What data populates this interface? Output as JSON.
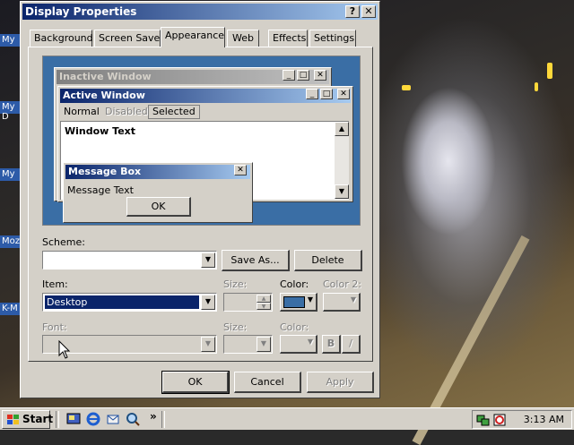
{
  "desktop": {
    "icons": [
      "My",
      "My D",
      "My",
      "Moz",
      "K-M"
    ]
  },
  "dialog": {
    "title": "Display Properties",
    "help_btn": "?",
    "close_btn": "✕",
    "tabs": [
      "Background",
      "Screen Saver",
      "Appearance",
      "Web",
      "Effects",
      "Settings"
    ],
    "active_tab": "Appearance"
  },
  "preview": {
    "inactive_title": "Inactive Window",
    "active_title": "Active Window",
    "menu_normal": "Normal",
    "menu_disabled": "Disabled",
    "menu_selected": "Selected",
    "window_text": "Window Text",
    "msgbox_title": "Message Box",
    "msgbox_text": "Message Text",
    "msgbox_ok": "OK"
  },
  "appearance": {
    "scheme_label": "Scheme:",
    "scheme_value": "",
    "save_as": "Save As...",
    "delete": "Delete",
    "item_label": "Item:",
    "item_value": "Desktop",
    "size_label": "Size:",
    "color_label": "Color:",
    "color2_label": "Color 2:",
    "font_label": "Font:",
    "font_size_label": "Size:",
    "font_color_label": "Color:",
    "bold": "B",
    "italic": "/",
    "item_color": "#3a6ea5"
  },
  "buttons": {
    "ok": "OK",
    "cancel": "Cancel",
    "apply": "Apply"
  },
  "taskbar": {
    "start": "Start",
    "chevron": "»",
    "time": "3:13 AM"
  }
}
